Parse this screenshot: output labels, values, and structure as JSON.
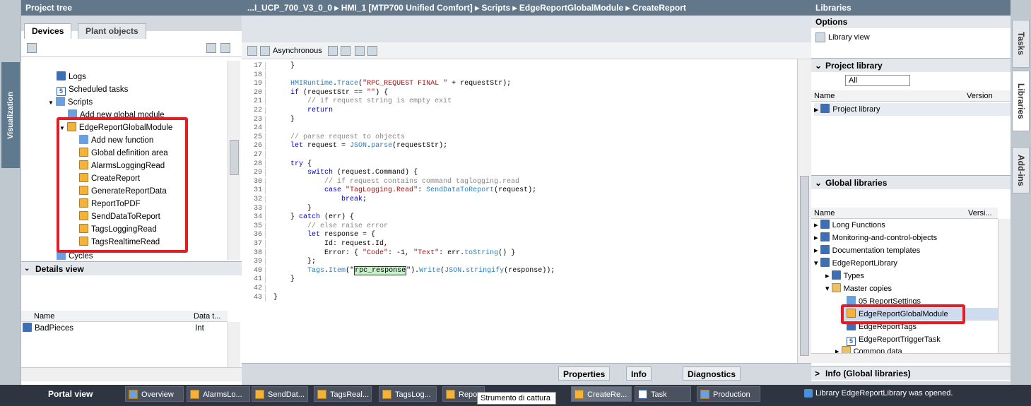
{
  "left_strip": {
    "label": "Visualization"
  },
  "project_tree": {
    "title": "Project tree",
    "tabs": [
      "Devices",
      "Plant objects"
    ],
    "items": [
      {
        "label": "Logs",
        "icon": "log-icon"
      },
      {
        "label": "Scheduled tasks",
        "icon": "task-icon"
      },
      {
        "label": "Scripts",
        "icon": "folder-icon"
      },
      {
        "label": "Add new global module",
        "icon": "add-icon"
      },
      {
        "label": "EdgeReportGlobalModule",
        "icon": "js-module-icon"
      },
      {
        "label": "Add new function",
        "icon": "add-icon"
      },
      {
        "label": "Global definition area",
        "icon": "js-icon"
      },
      {
        "label": "AlarmsLoggingRead",
        "icon": "js-icon"
      },
      {
        "label": "CreateReport",
        "icon": "js-icon"
      },
      {
        "label": "GenerateReportData",
        "icon": "js-icon"
      },
      {
        "label": "ReportToPDF",
        "icon": "js-icon"
      },
      {
        "label": "SendDataToReport",
        "icon": "js-icon"
      },
      {
        "label": "TagsLoggingRead",
        "icon": "js-icon"
      },
      {
        "label": "TagsRealtimeRead",
        "icon": "js-icon"
      },
      {
        "label": "Cycles",
        "icon": "folder-icon"
      }
    ]
  },
  "details_view": {
    "title": "Details view",
    "col_name": "Name",
    "col_type": "Data t...",
    "rows": [
      {
        "name": "BadPieces",
        "type": "Int"
      }
    ]
  },
  "editor": {
    "breadcrumb": "...I_UCP_700_V3_0_0 ▸ HMI_1 [MTP700 Unified Comfort] ▸ Scripts ▸ EdgeReportGlobalModule ▸ CreateReport",
    "toolbar_async": "Asynchronous",
    "lines": [
      {
        "n": "17",
        "t": "    }"
      },
      {
        "n": "18",
        "t": ""
      },
      {
        "n": "19",
        "t": "    HMIRuntime.Trace(\"RPC_REQUEST FINAL \" + requestStr);"
      },
      {
        "n": "20",
        "t": "    if (requestStr == \"\") {"
      },
      {
        "n": "21",
        "t": "        // if request string is empty exit"
      },
      {
        "n": "22",
        "t": "        return"
      },
      {
        "n": "23",
        "t": "    }"
      },
      {
        "n": "24",
        "t": ""
      },
      {
        "n": "25",
        "t": "    // parse request to objects"
      },
      {
        "n": "26",
        "t": "    let request = JSON.parse(requestStr);"
      },
      {
        "n": "27",
        "t": ""
      },
      {
        "n": "28",
        "t": "    try {"
      },
      {
        "n": "29",
        "t": "        switch (request.Command) {"
      },
      {
        "n": "30",
        "t": "            // if request contains command taglogging.read"
      },
      {
        "n": "31",
        "t": "            case \"TagLogging.Read\": SendDataToReport(request);"
      },
      {
        "n": "32",
        "t": "                break;"
      },
      {
        "n": "33",
        "t": "        }"
      },
      {
        "n": "34",
        "t": "    } catch (err) {"
      },
      {
        "n": "35",
        "t": "        // else raise error"
      },
      {
        "n": "36",
        "t": "        let response = {"
      },
      {
        "n": "37",
        "t": "            Id: request.Id,"
      },
      {
        "n": "38",
        "t": "            Error: { \"Code\": -1, \"Text\": err.toString() }"
      },
      {
        "n": "39",
        "t": "        };"
      },
      {
        "n": "40",
        "t": "        Tags.Item(\"rpc_response\").Write(JSON.stringify(response));"
      },
      {
        "n": "41",
        "t": "    }"
      },
      {
        "n": "42",
        "t": ""
      },
      {
        "n": "43",
        "t": "}"
      }
    ]
  },
  "bottom_tabs": {
    "properties": "Properties",
    "info": "Info",
    "diagnostics": "Diagnostics"
  },
  "libraries": {
    "title": "Libraries",
    "options": "Options",
    "library_view": "Library view",
    "project_library": {
      "title": "Project library",
      "filter": "All",
      "col_name": "Name",
      "col_version": "Version",
      "items": [
        "Project library"
      ]
    },
    "global_libraries": {
      "title": "Global libraries",
      "col_name": "Name",
      "col_version": "Versi...",
      "items": [
        "Long Functions",
        "Monitoring-and-control-objects",
        "Documentation templates",
        "EdgeReportLibrary",
        "Types",
        "Master copies",
        "05 ReportSettings",
        "EdgeReportGlobalModule",
        "EdgeReportTags",
        "EdgeReportTriggerTask",
        "Common data"
      ]
    },
    "info_panel": "Info (Global libraries)"
  },
  "right_tabs": [
    "Tasks",
    "Libraries",
    "Add-ins"
  ],
  "taskbar": {
    "portal": "Portal view",
    "items": [
      "Overview",
      "AlarmsLo...",
      "SendDat...",
      "TagsReal...",
      "TagsLog...",
      "Repo",
      "CreateRe...",
      "Task",
      "Production"
    ],
    "tooltip": "Strumento di cattura",
    "status": "Library EdgeReportLibrary was opened."
  }
}
